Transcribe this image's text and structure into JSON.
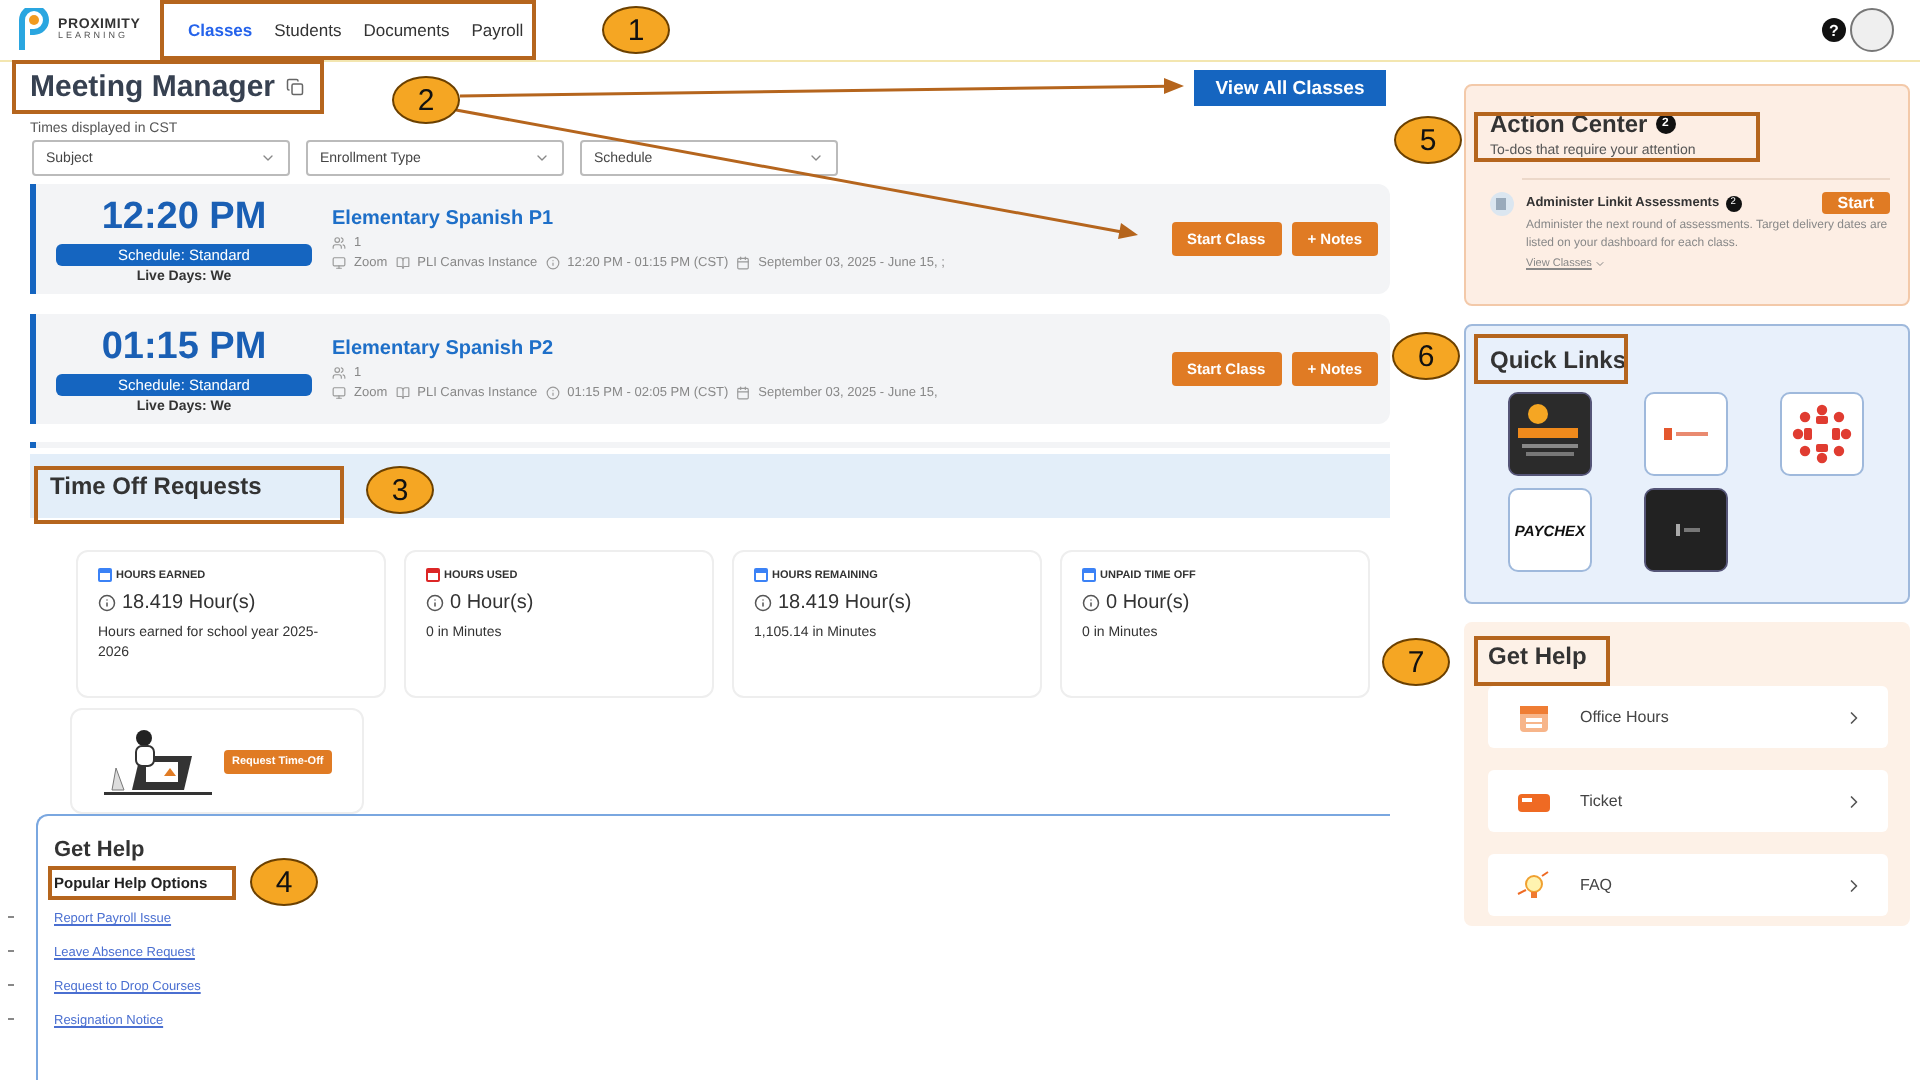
{
  "header": {
    "logo": {
      "name": "PROXIMITY",
      "sub": "LEARNING"
    },
    "nav": [
      {
        "label": "Classes",
        "selected": true
      },
      {
        "label": "Students",
        "selected": false
      },
      {
        "label": "Documents",
        "selected": false
      },
      {
        "label": "Payroll",
        "selected": false
      }
    ],
    "help_badge": "?"
  },
  "meeting_manager": {
    "title": "Meeting Manager",
    "subtitle": "Times displayed in CST",
    "view_all": "View All Classes",
    "filters": [
      {
        "placeholder": "Subject"
      },
      {
        "placeholder": "Enrollment Type"
      },
      {
        "placeholder": "Schedule"
      }
    ],
    "classes": [
      {
        "time": "12:20 PM",
        "schedule": "Schedule: Standard",
        "live_days": "Live Days: We",
        "title": "Elementary Spanish P1",
        "students": "1",
        "platform": "Zoom",
        "instance": "PLI Canvas Instance",
        "hours": "12:20 PM - 01:15 PM (CST)",
        "dates": "September 03, 2025 - June 15, ;",
        "buttons": [
          "Start Class",
          "+ Notes"
        ]
      },
      {
        "time": "01:15 PM",
        "schedule": "Schedule: Standard",
        "live_days": "Live Days: We",
        "title": "Elementary Spanish P2",
        "students": "1",
        "platform": "Zoom",
        "instance": "PLI Canvas Instance",
        "hours": "01:15 PM - 02:05 PM (CST)",
        "dates": "September 03, 2025 - June 15,",
        "buttons": [
          "Start Class",
          "+ Notes"
        ]
      }
    ]
  },
  "time_off": {
    "title": "Time Off Requests",
    "stats": [
      {
        "label": "HOURS EARNED",
        "color": "#3b82f6",
        "value": "18.419 Hour(s)",
        "note": "Hours earned for school year 2025-2026"
      },
      {
        "label": "HOURS USED",
        "color": "#dc2626",
        "value": "0 Hour(s)",
        "note": "0 in Minutes"
      },
      {
        "label": "HOURS REMAINING",
        "color": "#3b82f6",
        "value": "18.419 Hour(s)",
        "note": "1,105.14 in Minutes"
      },
      {
        "label": "UNPAID TIME OFF",
        "color": "#3b82f6",
        "value": "0 Hour(s)",
        "note": "0 in Minutes"
      }
    ],
    "request_button": "Request Time-Off"
  },
  "get_help_left": {
    "title": "Get Help",
    "subtitle": "Popular Help Options",
    "links": [
      "Report Payroll Issue",
      "Leave Absence Request",
      "Request to Drop Courses",
      "Resignation Notice"
    ]
  },
  "action_center": {
    "title": "Action Center",
    "count": "2",
    "subtitle": "To-dos that require your attention",
    "task": {
      "title": "Administer Linkit Assessments",
      "count": "2",
      "action": "Start",
      "description": "Administer the next round of assessments. Target delivery dates are listed on your dashboard for each class.",
      "link": "View Classes"
    }
  },
  "quick_links": {
    "title": "Quick Links",
    "items": [
      {
        "kind": "innovation"
      },
      {
        "kind": "kickup"
      },
      {
        "kind": "canvas"
      },
      {
        "kind": "paychex",
        "label": "PAYCHEX"
      },
      {
        "kind": "dark"
      }
    ]
  },
  "get_help_right": {
    "title": "Get Help",
    "items": [
      {
        "kind": "calendar",
        "label": "Office Hours"
      },
      {
        "kind": "ticket",
        "label": "Ticket"
      },
      {
        "kind": "bulb",
        "label": "FAQ"
      }
    ]
  },
  "annotations": [
    "1",
    "2",
    "3",
    "4",
    "5",
    "6",
    "7"
  ]
}
